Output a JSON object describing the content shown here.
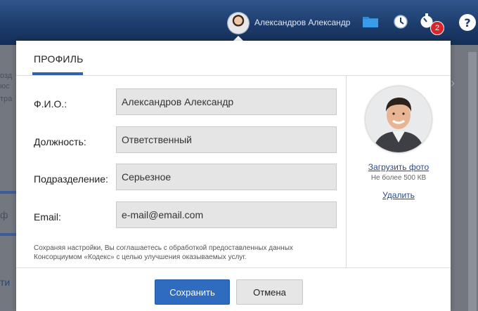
{
  "topbar": {
    "user_name": "Александров Александр",
    "notification_count": "2",
    "icons": [
      "folder-icon",
      "clock-icon",
      "timer-icon",
      "help-icon"
    ]
  },
  "background_page": {
    "fragments": [
      "озд",
      "юс",
      "тра",
      "ф",
      "ти"
    ]
  },
  "modal": {
    "tab_label": "ПРОФИЛЬ",
    "fields": {
      "name": {
        "label": "Ф.И.О.:",
        "value": "Александров Александр"
      },
      "position": {
        "label": "Должность:",
        "value": "Ответственный"
      },
      "department": {
        "label": "Подразделение:",
        "value": "Серьезное"
      },
      "email": {
        "label": "Email:",
        "value": "e-mail@email.com"
      }
    },
    "consent_text_line1": "Сохраняя настройки, Вы соглашаетесь с обработкой предоставленных данных",
    "consent_text_line2": "Консорциумом «Кодекс» с целью улучшения оказываемых услуг.",
    "photo": {
      "upload_label": "Загрузить фото",
      "size_note": "Не более 500 КВ",
      "delete_label": "Удалить"
    },
    "buttons": {
      "save": "Сохранить",
      "cancel": "Отмена"
    }
  },
  "colors": {
    "topbar": "#1d3c6c",
    "accent": "#2e62b0",
    "save_button": "#2f6bbf",
    "badge": "#d8262a",
    "link": "#2a4a86"
  }
}
